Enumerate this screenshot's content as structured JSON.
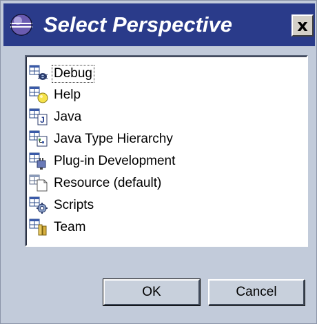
{
  "window": {
    "title": "Select Perspective",
    "close_label": "x"
  },
  "perspectives": [
    {
      "label": "Debug",
      "icon": "debug-perspective-icon",
      "selected": true
    },
    {
      "label": "Help",
      "icon": "help-perspective-icon"
    },
    {
      "label": "Java",
      "icon": "java-perspective-icon"
    },
    {
      "label": "Java Type Hierarchy",
      "icon": "java-type-hierarchy-icon"
    },
    {
      "label": "Plug-in Development",
      "icon": "plugin-development-icon"
    },
    {
      "label": "Resource (default)",
      "icon": "resource-perspective-icon"
    },
    {
      "label": "Scripts",
      "icon": "scripts-perspective-icon"
    },
    {
      "label": "Team",
      "icon": "team-perspective-icon"
    }
  ],
  "buttons": {
    "ok": "OK",
    "cancel": "Cancel"
  },
  "colors": {
    "title_bar": "#2a3b8a",
    "dialog_bg": "#c2cbda"
  }
}
